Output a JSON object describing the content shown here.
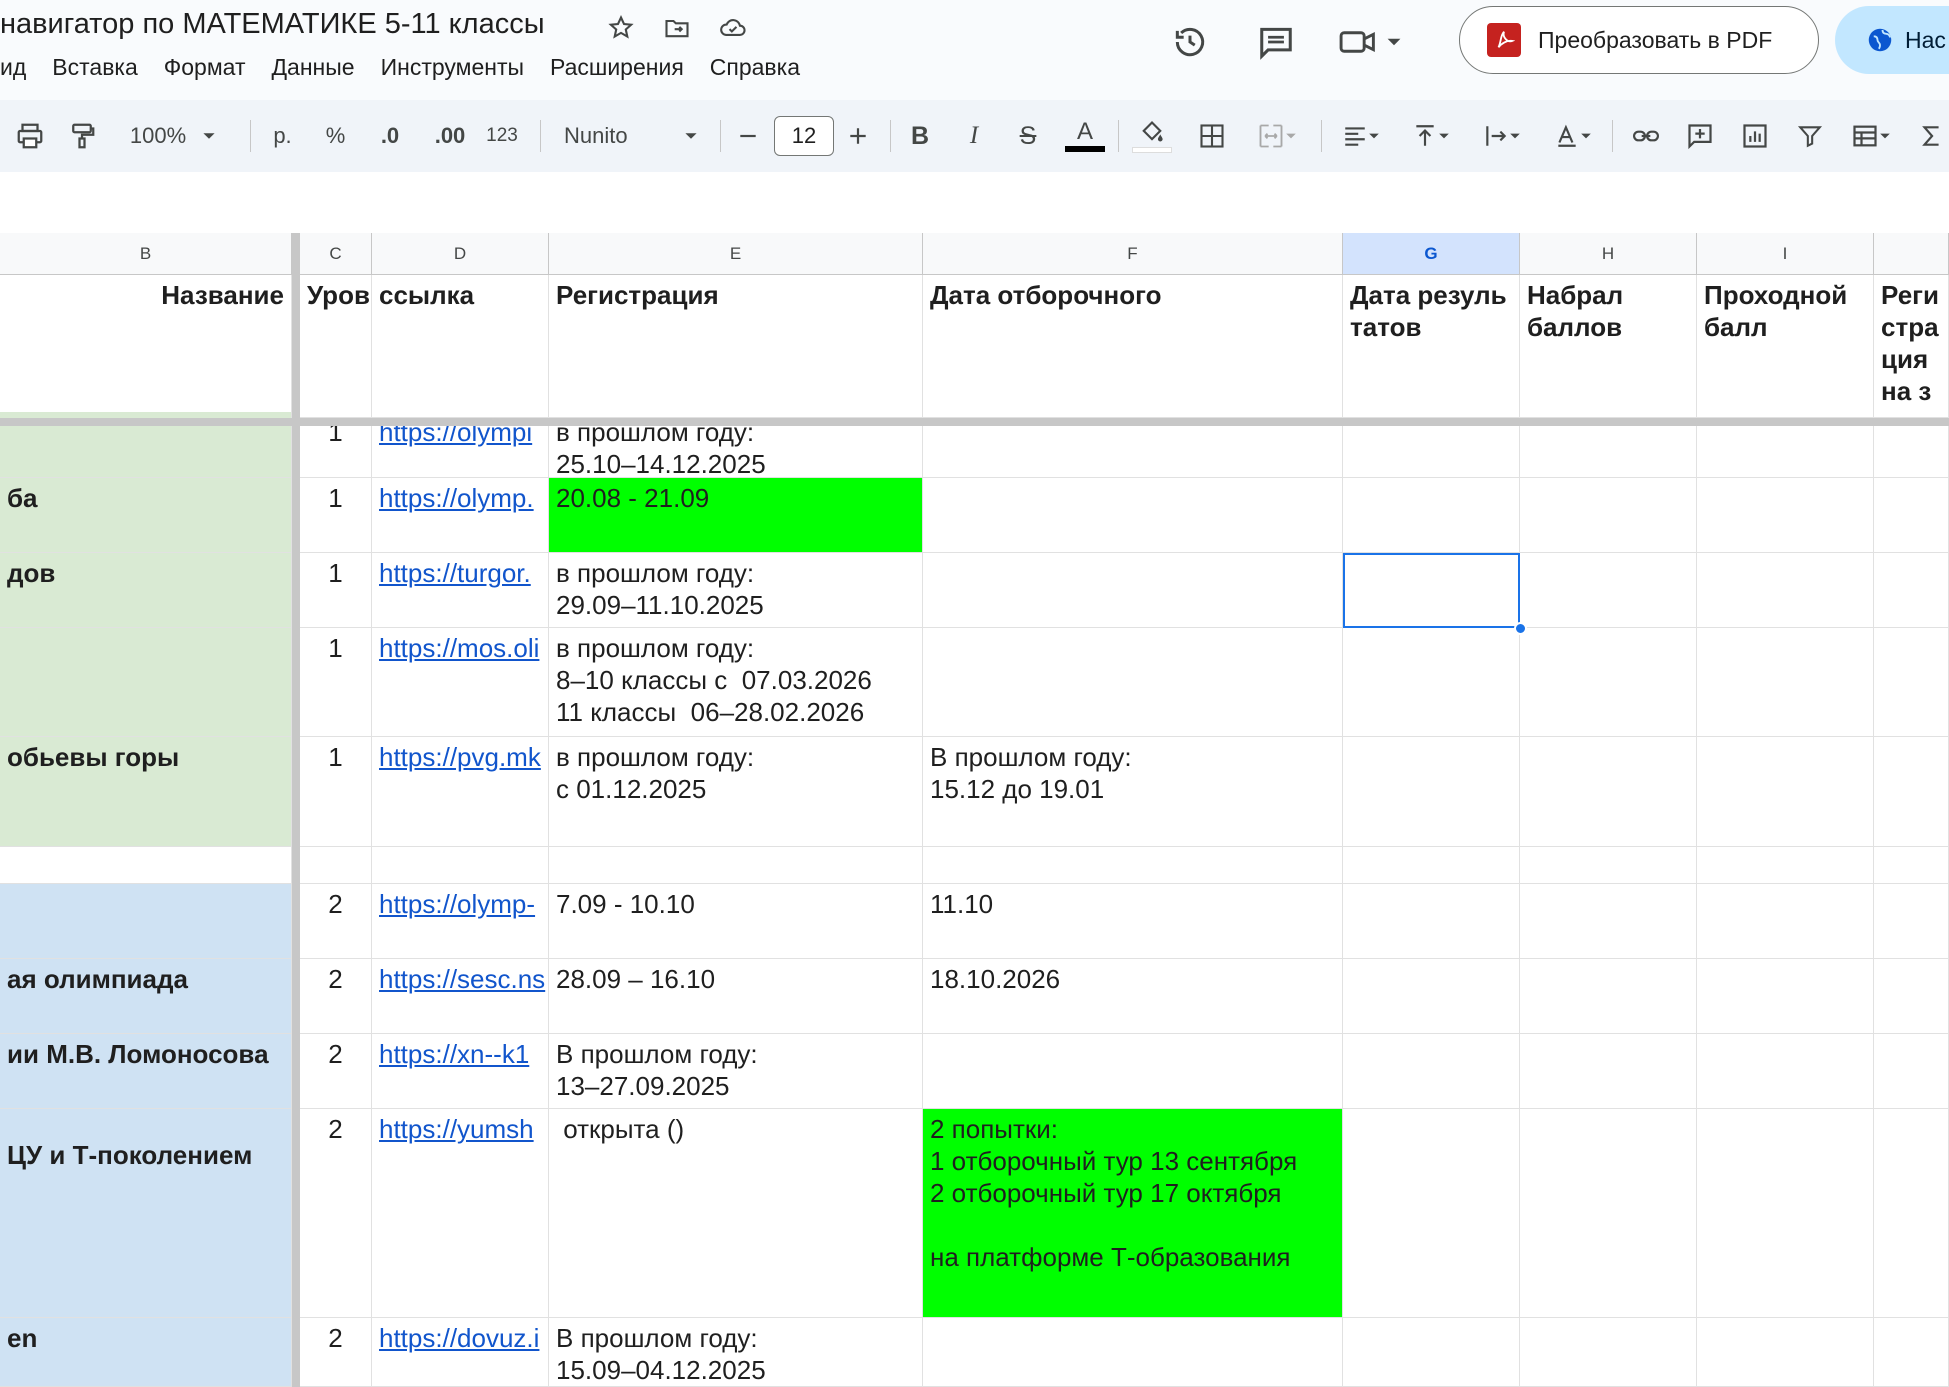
{
  "header": {
    "title": "навигатор по МАТЕМАТИКЕ 5-11 классы",
    "menu": [
      "ид",
      "Вставка",
      "Формат",
      "Данные",
      "Инструменты",
      "Расширения",
      "Справка"
    ],
    "pdf_button": "Преобразовать в PDF",
    "share_button": "Нас"
  },
  "toolbar": {
    "zoom": "100%",
    "currency": "р.",
    "percent": "%",
    "dec_less": ".0",
    "dec_more": ".00",
    "number_format": "123",
    "font": "Nunito",
    "font_size": "12",
    "bold": "B",
    "italic": "I",
    "strike": "S",
    "text_color": "A"
  },
  "grid": {
    "columns": [
      "B",
      "C",
      "D",
      "E",
      "F",
      "G",
      "H",
      "I"
    ],
    "selected_column": "G",
    "headers": {
      "name": "Название",
      "level": "Уров",
      "link": "ссылка",
      "registration": "Регистрация",
      "qualifier_date": "Дата отборочного",
      "results_date": "Дата результатов",
      "score": "Набрал баллов",
      "pass_score": "Проходной балл",
      "final_reg": "Регистрация на заключительный"
    },
    "rows": [
      {
        "name": "",
        "level": "1",
        "link": "https://olympi",
        "reg": "в прошлом году:\n25.10–14.12.2025",
        "qual": ""
      },
      {
        "name": "ба",
        "level": "1",
        "link": "https://olymp.",
        "reg": "20.08 - 21.09",
        "qual": ""
      },
      {
        "name": "дов",
        "level": "1",
        "link": "https://turgor.",
        "reg": "в прошлом году:\n29.09–11.10.2025",
        "qual": ""
      },
      {
        "name": "",
        "level": "1",
        "link": "https://mos.oli",
        "reg": "в прошлом году:\n8–10 классы с  07.03.2026\n11 классы  06–28.02.2026",
        "qual": ""
      },
      {
        "name": "обьевы горы",
        "level": "1",
        "link": "https://pvg.mk",
        "reg": "в прошлом году:\nс 01.12.2025",
        "qual": "В прошлом году:\n15.12 до 19.01"
      },
      {
        "name": "",
        "level": "",
        "link": "",
        "reg": "",
        "qual": ""
      },
      {
        "name": "",
        "level": "2",
        "link": "https://olymp-",
        "reg": "7.09 - 10.10",
        "qual": "11.10"
      },
      {
        "name": "ая олимпиада",
        "level": "2",
        "link": "https://sesc.ns",
        "reg": "28.09 – 16.10",
        "qual": "18.10.2026"
      },
      {
        "name": "ии М.В. Ломоносова",
        "level": "2",
        "link": "https://xn--k1",
        "reg": "В прошлом году:\n13–27.09.2025",
        "qual": ""
      },
      {
        "name": "ЦУ и Т-поколением",
        "level": "2",
        "link": "https://yumsh",
        "reg": " открыта ()",
        "qual": "2 попытки:\n1 отборочный тур 13 сентября\n2 отборочный тур 17 октября\n\nна платформе Т-образования"
      },
      {
        "name": "en",
        "level": "2",
        "link": "https://dovuz.i",
        "reg": "В прошлом году:\n15.09–04.12.2025",
        "qual": ""
      }
    ]
  },
  "colors": {
    "green_fill": "#00ff00",
    "group1_fill": "#d9ead3",
    "group2_fill": "#cfe2f3",
    "accent": "#1a73e8"
  }
}
